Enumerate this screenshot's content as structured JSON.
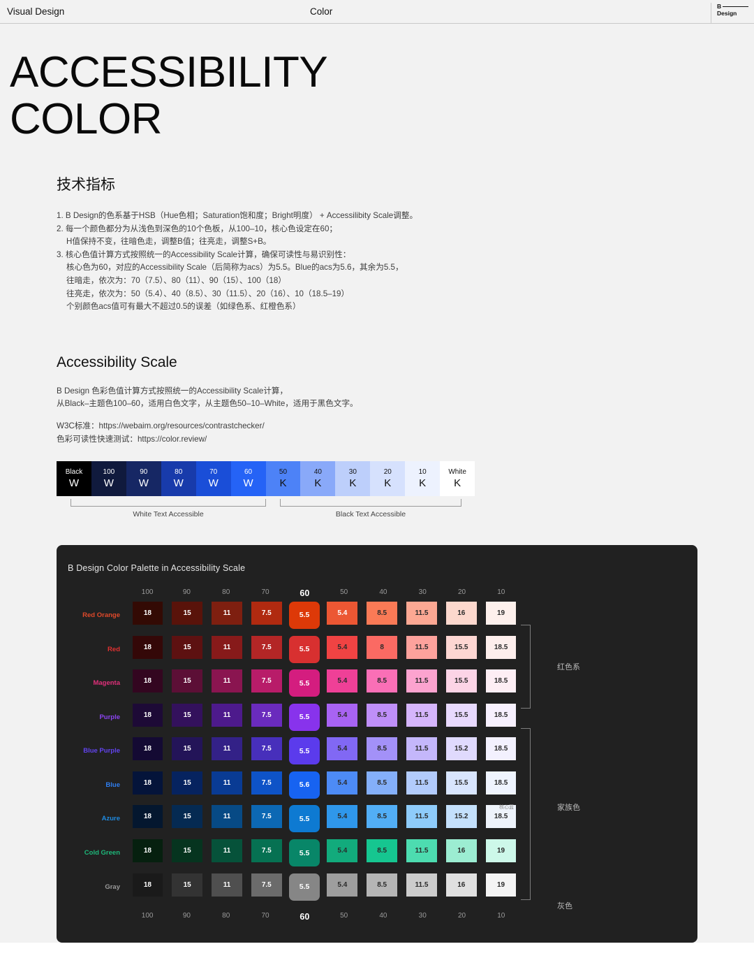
{
  "topbar": {
    "left_label": "Visual Design",
    "center_label": "Color",
    "brand_line1": "B",
    "brand_line2": "Design"
  },
  "hero": {
    "title_line1": "ACCESSIBILITY",
    "title_line2": "COLOR"
  },
  "specs": {
    "heading": "技术指标",
    "lines": [
      "1. B Design的色系基于HSB（Hue色相；Saturation饱和度；Bright明度） + Accessilibity Scale调整。",
      "2. 每一个颜色都分为从浅色到深色的10个色板，从100–10，核心色设定在60；",
      "H值保持不变，往暗色走，调整B值；往亮走，调整S+B。",
      "3. 核心色值计算方式按照统一的Accessibility Scale计算，确保可读性与易识别性：",
      "核心色为60，对应的Accessibility Scale（后简称为acs）为5.5。Blue的acs为5.6，其余为5.5，",
      "往暗走，依次为：70（7.5）、80（11）、90（15）、100（18）",
      "往亮走，依次为：50（5.4）、40（8.5）、30（11.5）、20（16）、10（18.5–19）",
      "个别颜色acs值可有最大不超过0.5的误差（如绿色系、红橙色系）"
    ],
    "indent_flags": [
      false,
      false,
      true,
      false,
      true,
      true,
      true,
      true
    ]
  },
  "accessibility_scale": {
    "heading": "Accessibility Scale",
    "para1_line1": "B Design 色彩色值计算方式按照统一的Accessibility Scale计算，",
    "para1_line2": "从Black–主题色100–60，适用白色文字，从主题色50–10–White，适用于黑色文字。",
    "para2_line1": "W3C标准：https://webaim.org/resources/contrastchecker/",
    "para2_line2": "色彩可读性快速测试：https://color.review/",
    "swatches": [
      {
        "n": "Black",
        "l": "W",
        "bg": "#000000",
        "fg": "#ffffff"
      },
      {
        "n": "100",
        "l": "W",
        "bg": "#101a3d",
        "fg": "#ffffff"
      },
      {
        "n": "90",
        "l": "W",
        "bg": "#162764",
        "fg": "#ffffff"
      },
      {
        "n": "80",
        "l": "W",
        "bg": "#183bab",
        "fg": "#ffffff"
      },
      {
        "n": "70",
        "l": "W",
        "bg": "#1a4ed8",
        "fg": "#ffffff"
      },
      {
        "n": "60",
        "l": "W",
        "bg": "#2563f6",
        "fg": "#ffffff"
      },
      {
        "n": "50",
        "l": "K",
        "bg": "#4d82f7",
        "fg": "#111111"
      },
      {
        "n": "40",
        "l": "K",
        "bg": "#89a9f9",
        "fg": "#111111"
      },
      {
        "n": "30",
        "l": "K",
        "bg": "#bdcffb",
        "fg": "#111111"
      },
      {
        "n": "20",
        "l": "K",
        "bg": "#d6e1fd",
        "fg": "#111111"
      },
      {
        "n": "10",
        "l": "K",
        "bg": "#edf2fe",
        "fg": "#111111"
      },
      {
        "n": "White",
        "l": "K",
        "bg": "#ffffff",
        "fg": "#111111"
      }
    ],
    "bracket_left_label": "White Text Accessible",
    "bracket_right_label": "Black Text Accessible"
  },
  "palette": {
    "title": "B Design Color Palette in Accessibility Scale",
    "columns": [
      "100",
      "90",
      "80",
      "70",
      "60",
      "50",
      "40",
      "30",
      "20",
      "10"
    ],
    "core_column_index": 4,
    "annotations": {
      "red_family": "红色系",
      "family_colors": "家族色",
      "gray": "灰色",
      "core_blue": "核心蓝"
    },
    "rows": [
      {
        "name": "Red Orange",
        "label_color": "#e0492a",
        "values": [
          "18",
          "15",
          "11",
          "7.5",
          "5.5",
          "5.4",
          "8.5",
          "11.5",
          "16",
          "19"
        ],
        "bgs": [
          "#330a04",
          "#59130a",
          "#7e1f10",
          "#b02a10",
          "#dd3908",
          "#ec5733",
          "#fa7a56",
          "#fca893",
          "#fcd8cd",
          "#fdf0ec"
        ],
        "fgs": [
          "#ffffff",
          "#ffffff",
          "#ffffff",
          "#ffffff",
          "#ffffff",
          "#ffffff",
          "#2a2a2a",
          "#2a2a2a",
          "#2a2a2a",
          "#2a2a2a"
        ]
      },
      {
        "name": "Red",
        "label_color": "#e03131",
        "values": [
          "18",
          "15",
          "11",
          "7.5",
          "5.5",
          "5.4",
          "8",
          "11.5",
          "15.5",
          "18.5"
        ],
        "bgs": [
          "#340808",
          "#5d1111",
          "#871a1a",
          "#b32626",
          "#d83030",
          "#f04343",
          "#fb6a63",
          "#fda29c",
          "#fdd6d2",
          "#fdeeec"
        ],
        "fgs": [
          "#ffffff",
          "#ffffff",
          "#ffffff",
          "#ffffff",
          "#ffffff",
          "#2a2a2a",
          "#2a2a2a",
          "#2a2a2a",
          "#2a2a2a",
          "#2a2a2a"
        ]
      },
      {
        "name": "Magenta",
        "label_color": "#e0307a",
        "values": [
          "18",
          "15",
          "11",
          "7.5",
          "5.5",
          "5.4",
          "8.5",
          "11.5",
          "15.5",
          "18.5"
        ],
        "bgs": [
          "#330620",
          "#5c0f36",
          "#8a1550",
          "#b81c69",
          "#d41d7f",
          "#ef4097",
          "#fa6fb6",
          "#fca3cf",
          "#fcd4e6",
          "#fdeef4"
        ],
        "fgs": [
          "#ffffff",
          "#ffffff",
          "#ffffff",
          "#ffffff",
          "#ffffff",
          "#2a2a2a",
          "#2a2a2a",
          "#2a2a2a",
          "#2a2a2a",
          "#2a2a2a"
        ]
      },
      {
        "name": "Purple",
        "label_color": "#8b44f0",
        "values": [
          "18",
          "15",
          "11",
          "7.5",
          "5.5",
          "5.4",
          "8.5",
          "11.5",
          "15.5",
          "18.5"
        ],
        "bgs": [
          "#1d0a36",
          "#33115c",
          "#4d1a8c",
          "#6a2bbd",
          "#8833ec",
          "#a863f3",
          "#bf8ff8",
          "#d5b5fb",
          "#e8d9fd",
          "#f7f0fe"
        ],
        "fgs": [
          "#ffffff",
          "#ffffff",
          "#ffffff",
          "#ffffff",
          "#ffffff",
          "#2a2a2a",
          "#2a2a2a",
          "#2a2a2a",
          "#2a2a2a",
          "#2a2a2a"
        ]
      },
      {
        "name": "Blue Purple",
        "label_color": "#6244ef",
        "values": [
          "18",
          "15",
          "11",
          "7.5",
          "5.5",
          "5.4",
          "8.5",
          "11.5",
          "15.2",
          "18.5"
        ],
        "bgs": [
          "#140a33",
          "#231458",
          "#332187",
          "#472fbb",
          "#5b3bec",
          "#8168f4",
          "#a391f8",
          "#c4b7fb",
          "#e0dafd",
          "#f3f1fe"
        ],
        "fgs": [
          "#ffffff",
          "#ffffff",
          "#ffffff",
          "#ffffff",
          "#ffffff",
          "#2a2a2a",
          "#2a2a2a",
          "#2a2a2a",
          "#2a2a2a",
          "#2a2a2a"
        ]
      },
      {
        "name": "Blue",
        "label_color": "#2f7ef0",
        "values": [
          "18",
          "15",
          "11",
          "7.5",
          "5.6",
          "5.4",
          "8.5",
          "11.5",
          "15.5",
          "18.5"
        ],
        "bgs": [
          "#04143a",
          "#06235f",
          "#093b94",
          "#0e53c7",
          "#1763f1",
          "#4d8bf6",
          "#84aff9",
          "#b2cbfb",
          "#d8e5fd",
          "#eff4fe"
        ],
        "fgs": [
          "#ffffff",
          "#ffffff",
          "#ffffff",
          "#ffffff",
          "#ffffff",
          "#2a2a2a",
          "#2a2a2a",
          "#2a2a2a",
          "#2a2a2a",
          "#2a2a2a"
        ]
      },
      {
        "name": "Azure",
        "label_color": "#1f8ae0",
        "values": [
          "18",
          "15",
          "11",
          "7.5",
          "5.5",
          "5.4",
          "8.5",
          "11.5",
          "15.2",
          "18.5"
        ],
        "bgs": [
          "#04172f",
          "#052a52",
          "#074a85",
          "#0c68b4",
          "#0e7ad2",
          "#2f97eb",
          "#52aef6",
          "#8ecbfa",
          "#c4e0fc",
          "#eef3fb"
        ],
        "fgs": [
          "#ffffff",
          "#ffffff",
          "#ffffff",
          "#ffffff",
          "#ffffff",
          "#2a2a2a",
          "#2a2a2a",
          "#2a2a2a",
          "#2a2a2a",
          "#2a2a2a"
        ]
      },
      {
        "name": "Cold Green",
        "label_color": "#1db87a",
        "values": [
          "18",
          "15",
          "11",
          "7.5",
          "5.5",
          "5.4",
          "8.5",
          "11.5",
          "16",
          "19"
        ],
        "bgs": [
          "#06200f",
          "#06341f",
          "#06523a",
          "#067152",
          "#088668",
          "#12ab7c",
          "#16c690",
          "#4ddcb0",
          "#9cedd2",
          "#cdf8e9"
        ],
        "fgs": [
          "#ffffff",
          "#ffffff",
          "#ffffff",
          "#ffffff",
          "#ffffff",
          "#2a2a2a",
          "#2a2a2a",
          "#2a2a2a",
          "#2a2a2a",
          "#2a2a2a"
        ]
      },
      {
        "name": "Gray",
        "label_color": "#9b9b9b",
        "values": [
          "18",
          "15",
          "11",
          "7.5",
          "5.5",
          "5.4",
          "8.5",
          "11.5",
          "16",
          "19"
        ],
        "bgs": [
          "#1a1a1a",
          "#333333",
          "#4f4f4f",
          "#6b6b6b",
          "#868686",
          "#9e9e9e",
          "#b5b5b5",
          "#cccccc",
          "#e0e0e0",
          "#f4f4f4"
        ],
        "fgs": [
          "#ffffff",
          "#ffffff",
          "#ffffff",
          "#ffffff",
          "#ffffff",
          "#2a2a2a",
          "#2a2a2a",
          "#2a2a2a",
          "#2a2a2a",
          "#2a2a2a"
        ]
      }
    ]
  }
}
